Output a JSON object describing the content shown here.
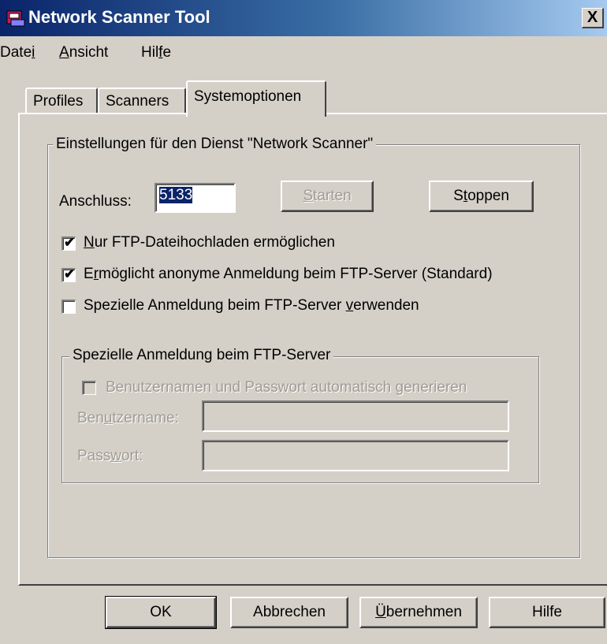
{
  "window": {
    "title": "Network Scanner Tool",
    "close_glyph": "X",
    "icon": "scanner-app-icon"
  },
  "menu": [
    {
      "pre": "Date",
      "u": "i",
      "post": ""
    },
    {
      "pre": "",
      "u": "A",
      "post": "nsicht"
    },
    {
      "pre": "Hil",
      "u": "f",
      "post": "e"
    }
  ],
  "tabs": [
    {
      "label": "Profiles",
      "active": false
    },
    {
      "label": "Scanners",
      "active": false
    },
    {
      "label": "Systemoptionen",
      "active": true
    }
  ],
  "service_group": {
    "title": "Einstellungen für den Dienst \"Network Scanner\"",
    "port_label": "Anschluss:",
    "port_value": "5133",
    "start_button": {
      "pre": "",
      "u": "S",
      "post": "tarten",
      "enabled": false
    },
    "stop_button": {
      "pre": "S",
      "u": "t",
      "post": "oppen",
      "enabled": true
    }
  },
  "options": [
    {
      "pre": "",
      "u": "N",
      "post": "ur FTP-Dateihochladen ermöglichen",
      "checked": true
    },
    {
      "pre": "E",
      "u": "r",
      "post": "möglicht anonyme Anmeldung beim FTP-Server (Standard)",
      "checked": true
    },
    {
      "pre": "Spezielle Anmeldung beim FTP-Server ",
      "u": "v",
      "post": "erwenden",
      "checked": false
    }
  ],
  "ftp_group": {
    "title": "Spezielle Anmeldung beim FTP-Server",
    "autogen_label": "Benutzernamen und Passwort automatisch generieren",
    "autogen_checked": false,
    "username": {
      "pre": "Ben",
      "u": "u",
      "post": "tzername:",
      "value": ""
    },
    "password": {
      "pre": "Pass",
      "u": "w",
      "post": "ort:",
      "value": ""
    }
  },
  "footer": {
    "ok": {
      "pre": "",
      "u": "",
      "post": "OK"
    },
    "cancel": {
      "pre": "",
      "u": "",
      "post": "Abbrechen"
    },
    "apply": {
      "pre": "",
      "u": "Ü",
      "post": "bernehmen"
    },
    "help": {
      "pre": "",
      "u": "",
      "post": "Hilfe"
    }
  }
}
